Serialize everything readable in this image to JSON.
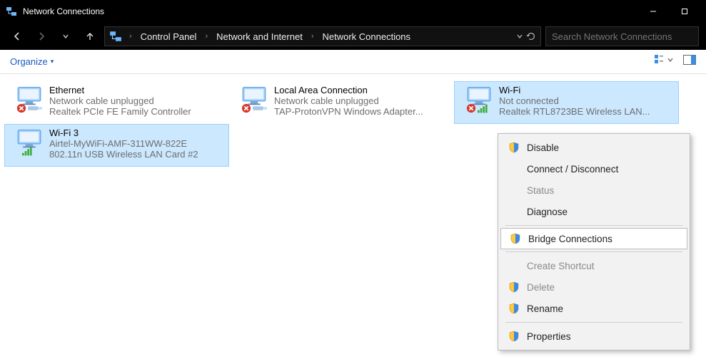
{
  "window": {
    "title": "Network Connections"
  },
  "breadcrumb": {
    "items": [
      "Control Panel",
      "Network and Internet",
      "Network Connections"
    ]
  },
  "search": {
    "placeholder": "Search Network Connections"
  },
  "toolbar": {
    "organize": "Organize"
  },
  "connections": [
    {
      "name": "Ethernet",
      "status": "Network cable unplugged",
      "device": "Realtek PCIe FE Family Controller",
      "selected": false,
      "kind": "wired",
      "error": true
    },
    {
      "name": "Local Area Connection",
      "status": "Network cable unplugged",
      "device": "TAP-ProtonVPN Windows Adapter...",
      "selected": false,
      "kind": "wired",
      "error": true
    },
    {
      "name": "Wi-Fi",
      "status": "Not connected",
      "device": "Realtek RTL8723BE Wireless LAN...",
      "selected": true,
      "kind": "wifi",
      "error": true
    },
    {
      "name": "Wi-Fi 3",
      "status": "Airtel-MyWiFi-AMF-311WW-822E",
      "device": "802.11n USB Wireless LAN Card #2",
      "selected": true,
      "kind": "wifi",
      "error": false
    }
  ],
  "context_menu": {
    "items": [
      {
        "label": "Disable",
        "shield": true,
        "enabled": true
      },
      {
        "label": "Connect / Disconnect",
        "shield": false,
        "enabled": true
      },
      {
        "label": "Status",
        "shield": false,
        "enabled": false
      },
      {
        "label": "Diagnose",
        "shield": false,
        "enabled": true
      },
      {
        "sep": true
      },
      {
        "label": "Bridge Connections",
        "shield": true,
        "enabled": true,
        "hover": true
      },
      {
        "sep": true
      },
      {
        "label": "Create Shortcut",
        "shield": false,
        "enabled": false
      },
      {
        "label": "Delete",
        "shield": true,
        "enabled": false
      },
      {
        "label": "Rename",
        "shield": true,
        "enabled": true
      },
      {
        "sep": true
      },
      {
        "label": "Properties",
        "shield": true,
        "enabled": true
      }
    ]
  }
}
